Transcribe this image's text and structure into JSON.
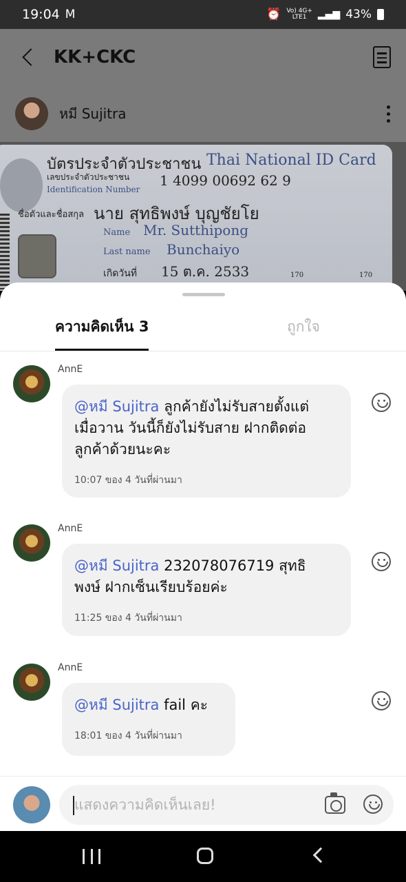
{
  "status_bar": {
    "time": "19:04",
    "indicators_top": "Vo) 4G+",
    "indicators_bottom": "LTE1",
    "battery": "43%"
  },
  "header": {
    "title": "KK+CKC"
  },
  "post": {
    "author": "หมี Sujitra"
  },
  "id_card": {
    "title_th": "บัตรประจำตัวประชาชน",
    "title_en": "Thai National ID Card",
    "id_label_th": "เลขประจำตัวประชาชน",
    "id_label_en": "Identification Number",
    "id_number": "1 4099 00692 62 9",
    "name_label_th": "ชื่อตัวและชื่อสกุล",
    "name_th": "นาย สุทธิพงษ์ บุญชัยโย",
    "name_label_en": "Name",
    "name_en": "Mr. Sutthipong",
    "lastname_label_en": "Last name",
    "lastname_en": "Bunchaiyo",
    "birth_label_th": "เกิดวันที่",
    "birth_th": "15 ต.ค. 2533",
    "height_left": "170",
    "height_right": "170"
  },
  "tabs": {
    "comments": "ความคิดเห็น 3",
    "likes": "ถูกใจ"
  },
  "comments": [
    {
      "author": "AnnE",
      "mention": "@หมี Sujitra",
      "line1": " ลูกค้ายังไม่รับสายตั้งแต่",
      "line2": "เมื่อวาน วันนี้ก็ยังไม่รับสาย ฝากติดต่อ",
      "line3": "ลูกค้าด้วยนะคะ",
      "time": "10:07 ของ 4 วันที่ผ่านมา"
    },
    {
      "author": "AnnE",
      "mention": "@หมี Sujitra",
      "line1": " 232078076719 สุทธิ",
      "line2": "พงษ์ ฝากเซ็นเรียบร้อยค่ะ",
      "time": "11:25 ของ 4 วันที่ผ่านมา"
    },
    {
      "author": "AnnE",
      "mention": "@หมี Sujitra",
      "line1": " fail คะ",
      "time": "18:01 ของ 4 วันที่ผ่านมา"
    }
  ],
  "composer": {
    "placeholder": "แสดงความคิดเห็นเลย!"
  }
}
